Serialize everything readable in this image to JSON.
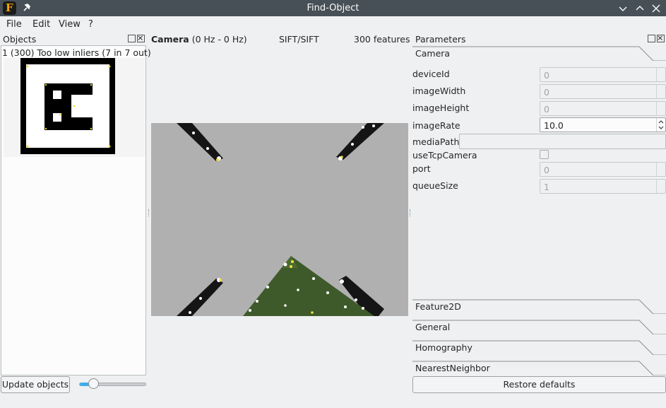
{
  "window": {
    "title": "Find-Object",
    "app_icon_letter": "F"
  },
  "menu": [
    "File",
    "Edit",
    "View",
    "?"
  ],
  "objects_dock": {
    "title": "Objects",
    "object_label": "1 (300)  Too low inliers (7 in 7 out)",
    "update_button": "Update objects",
    "slider_value_pct": 20
  },
  "camera": {
    "title": "Camera",
    "rate": "(0 Hz - 0 Hz)",
    "detector": "SIFT/SIFT",
    "features": "300 features"
  },
  "parameters": {
    "title": "Parameters",
    "active_tab": "Camera",
    "rows": {
      "deviceId": {
        "label": "deviceId",
        "value": "0"
      },
      "imageWidth": {
        "label": "imageWidth",
        "value": "0"
      },
      "imageHeight": {
        "label": "imageHeight",
        "value": "0"
      },
      "imageRate": {
        "label": "imageRate",
        "value": "10.0"
      },
      "mediaPath": {
        "label": "mediaPath",
        "value": ""
      },
      "useTcpCamera": {
        "label": "useTcpCamera",
        "checked": false
      },
      "port": {
        "label": "port",
        "value": "0"
      },
      "queueSize": {
        "label": "queueSize",
        "value": "1"
      }
    },
    "other_tabs": [
      "Feature2D",
      "General",
      "Homography",
      "NearestNeighbor"
    ],
    "restore_button": "Restore defaults"
  },
  "colors": {
    "titlebar": "#475057",
    "accent": "#3daee9",
    "window_bg": "#eff0f1"
  }
}
